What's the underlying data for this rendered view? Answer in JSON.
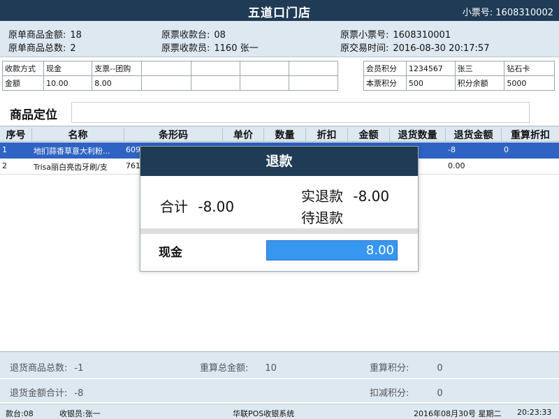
{
  "header": {
    "store_name": "五道口门店",
    "ticket_label": "小票号:",
    "ticket_number": "1608310002"
  },
  "original_info": {
    "amount_label": "原单商品金额:",
    "amount_value": "18",
    "count_label": "原单商品总数:",
    "count_value": "2",
    "register_label": "原票收款台:",
    "register_value": "08",
    "cashier_label": "原票收款员:",
    "cashier_value": "1160 张一",
    "ticket_label": "原票小票号:",
    "ticket_value": "1608310001",
    "time_label": "原交易时间:",
    "time_value": "2016-08-30 20:17:57"
  },
  "payment_table": {
    "row1": [
      "收款方式",
      "现金",
      "支票--团购",
      "",
      "",
      "",
      ""
    ],
    "row2": [
      "金额",
      "10.00",
      "8.00",
      "",
      "",
      "",
      ""
    ]
  },
  "member_table": {
    "row1": [
      "会员积分",
      "1234567",
      "张三",
      "钻石卡"
    ],
    "row2": [
      "本票积分",
      "500",
      "积分余额",
      "5000"
    ]
  },
  "locator": {
    "label": "商品定位",
    "value": ""
  },
  "products": {
    "columns": [
      "序号",
      "名称",
      "条形码",
      "单价",
      "数量",
      "折扣",
      "金额",
      "退货数量",
      "退货金额",
      "重算折扣"
    ],
    "rows": [
      {
        "no": "1",
        "name": "地扪蒜香草意大利粉...",
        "barcode": "609",
        "refund_amount": "-8",
        "recalc_discount": "0"
      },
      {
        "no": "2",
        "name": "Trisa丽白亮齿牙刷/支",
        "barcode": "7610",
        "refund_amount": "0.00",
        "recalc_discount": ""
      }
    ]
  },
  "summary": {
    "return_count_label": "退货商品总数:",
    "return_count_value": "-1",
    "recalc_total_label": "重算总金额:",
    "recalc_total_value": "10",
    "recalc_points_label": "重算积分:",
    "recalc_points_value": "0",
    "return_amount_label": "退货金额合计:",
    "return_amount_value": "-8",
    "deduct_points_label": "扣减积分:",
    "deduct_points_value": "0"
  },
  "status_bar": {
    "register": "款台:08",
    "cashier": "收银员:张一",
    "system": "华联POS收银系统",
    "date": "2016年08月30号 星期二",
    "time": "20:23:33"
  },
  "refund_dialog": {
    "title": "退款",
    "total_label": "合计",
    "total_value": "-8.00",
    "actual_label": "实退款",
    "actual_value": "-8.00",
    "pending_label": "待退款",
    "cash_label": "现金",
    "cash_value": "8.00"
  },
  "colors": {
    "dark_header": "#1f3b55",
    "panel_bg": "#dde8f1",
    "selection": "#2f63c3",
    "input_highlight": "#3796f0"
  }
}
